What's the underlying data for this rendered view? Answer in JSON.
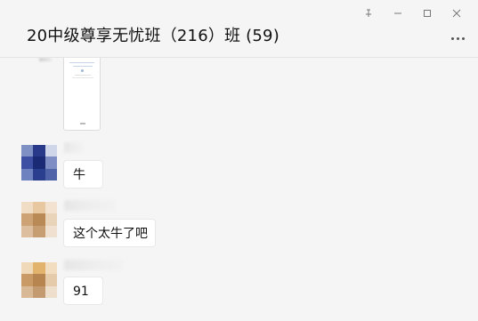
{
  "window": {
    "title": "20中级尊享无忧班（216）班 (59)",
    "controls": {
      "pin": "pin-icon",
      "minimize": "minimize-icon",
      "maximize": "maximize-icon",
      "close": "close-icon"
    },
    "more": "more-options-icon"
  },
  "messages": [
    {
      "type": "image"
    },
    {
      "type": "text",
      "text": "牛"
    },
    {
      "type": "text",
      "text": "这个太牛了吧"
    },
    {
      "type": "text",
      "text": "91"
    }
  ],
  "colors": {
    "background": "#f5f5f5",
    "bubble": "#ffffff",
    "title_text": "#111111"
  }
}
